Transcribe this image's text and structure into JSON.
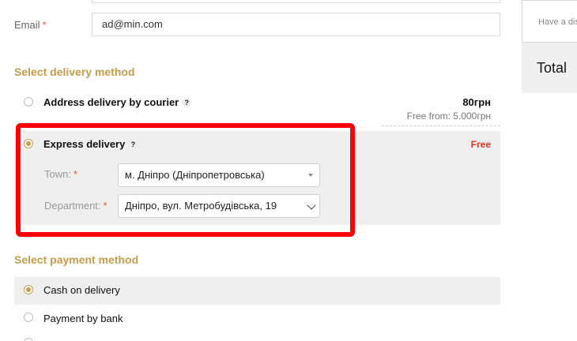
{
  "contact": {
    "email_label": "Email",
    "required_mark": "*",
    "email_value": "ad@min.com"
  },
  "delivery": {
    "title": "Select delivery method",
    "options": [
      {
        "label": "Address delivery by courier",
        "price": "80грн",
        "note": "Free from: 5.000грн",
        "selected": false
      },
      {
        "label": "Express delivery",
        "price": "Free",
        "selected": true
      }
    ],
    "help_glyph": "?",
    "town_label": "Town:",
    "town_value": "м. Дніпро (Дніпропетровська)",
    "department_label": "Department:",
    "department_value": "Дніпро, вул. Метробудівська, 19"
  },
  "payment": {
    "title": "Select payment method",
    "options": [
      {
        "label": "Cash on delivery",
        "selected": true
      },
      {
        "label": "Payment by bank",
        "selected": false
      }
    ]
  },
  "sidebar": {
    "discount_placeholder": "Have a dis",
    "total_label": "Total"
  },
  "colors": {
    "accent": "#c89b4a",
    "free": "#d9341e",
    "highlight": "#ff0000"
  }
}
